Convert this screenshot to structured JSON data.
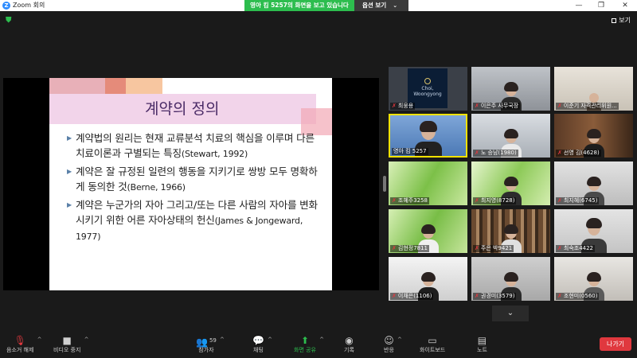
{
  "window": {
    "title": "Zoom 회의",
    "app_logo": "Z"
  },
  "share_banner": {
    "message": "영아 킴 5257의 화면을 보고 있습니다",
    "options_label": "옵션 보기"
  },
  "view_button": {
    "label": "보기"
  },
  "slide": {
    "title": "계약의 정의",
    "bullets": [
      {
        "text": "계약법의 원리는 현재 교류분석 치료의 핵심을 이루며 다른 치료이론과 구별되는 특징",
        "cite": "(Stewart, 1992)"
      },
      {
        "text": "계약은 잘 규정된 일련의 행동을 지키기로 쌍방 모두 명확하게 동의한 것",
        "cite": "(Berne, 1966)"
      },
      {
        "text": "계약은 누군가의 자아 그리고/또는 다른 사람의 자아를 변화시키기 위한 어른 자아상태의 헌신",
        "cite": "(James & Jongeward, 1977)"
      }
    ]
  },
  "participants": [
    {
      "name": "최웅용",
      "logo_text": "Choi, Woongyong"
    },
    {
      "name": "이은주 사무국장"
    },
    {
      "name": "이준기 자격관리위원..."
    },
    {
      "name": "영아 킴 5257",
      "active": true
    },
    {
      "name": "노 승남(1980)"
    },
    {
      "name": "선영 김(4628)"
    },
    {
      "name": "조혜주3258"
    },
    {
      "name": "최지영(8728)"
    },
    {
      "name": "최지혜(6745)"
    },
    {
      "name": "김현정7811"
    },
    {
      "name": "주은 박9421"
    },
    {
      "name": "최숙조4422"
    },
    {
      "name": "이채은(1106)"
    },
    {
      "name": "권경미(3579)"
    },
    {
      "name": "조현미(0560)"
    }
  ],
  "toolbar": {
    "mute": "음소거 해제",
    "video": "비디오 중지",
    "participants": "참가자",
    "participants_count": "59",
    "chat": "채팅",
    "share": "화면 공유",
    "record": "기록",
    "reactions": "반응",
    "whiteboard": "화이트보드",
    "notes": "노트",
    "leave": "나가기"
  },
  "colors": {
    "accent_green": "#2dbd4e",
    "leave_red": "#e0383e",
    "active_border": "#f2e200"
  }
}
